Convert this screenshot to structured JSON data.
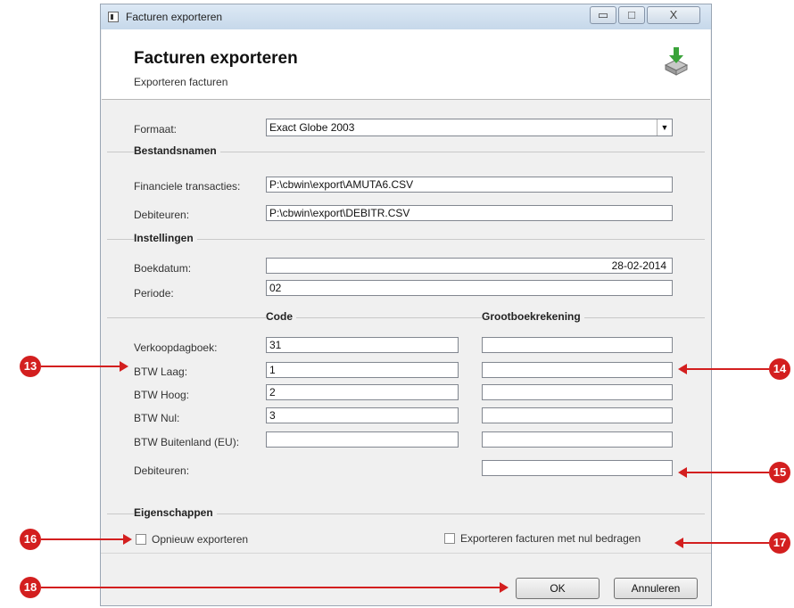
{
  "window": {
    "title": "Facturen exporteren",
    "min_glyph": "▭",
    "max_glyph": "□",
    "close_glyph": "X"
  },
  "header": {
    "title": "Facturen exporteren",
    "subtitle": "Exporteren facturen",
    "icon": "export-printer-icon"
  },
  "form": {
    "format": {
      "label": "Formaat:",
      "value": "Exact Globe 2003",
      "dropdown_glyph": "▼"
    },
    "bestandsnamen": {
      "heading": "Bestandsnamen",
      "financiele": {
        "label": "Financiele transacties:",
        "value": "P:\\cbwin\\export\\AMUTA6.CSV"
      },
      "debiteuren": {
        "label": "Debiteuren:",
        "value": "P:\\cbwin\\export\\DEBITR.CSV"
      }
    },
    "instellingen": {
      "heading": "Instellingen",
      "boekdatum": {
        "label": "Boekdatum:",
        "value": "28-02-2014"
      },
      "periode": {
        "label": "Periode:",
        "value": "02"
      }
    },
    "codes": {
      "code_heading": "Code",
      "gb_heading": "Grootboekrekening",
      "rows": [
        {
          "label": "Verkoopdagboek:",
          "code": "31",
          "gb": ""
        },
        {
          "label": "BTW Laag:",
          "code": "1",
          "gb": ""
        },
        {
          "label": "BTW Hoog:",
          "code": "2",
          "gb": ""
        },
        {
          "label": "BTW Nul:",
          "code": "3",
          "gb": ""
        },
        {
          "label": "BTW Buitenland (EU):",
          "code": "",
          "gb": ""
        }
      ],
      "debiteuren": {
        "label": "Debiteuren:",
        "gb": ""
      }
    },
    "eigenschappen": {
      "heading": "Eigenschappen",
      "opnieuw": {
        "label": "Opnieuw exporteren",
        "checked": false
      },
      "nul_bedragen": {
        "label": "Exporteren facturen met nul bedragen",
        "checked": false
      }
    }
  },
  "buttons": {
    "ok": "OK",
    "cancel": "Annuleren"
  },
  "callouts": [
    "13",
    "14",
    "15",
    "16",
    "17",
    "18"
  ],
  "colors": {
    "callout": "#d31f1f",
    "dialog_bg": "#f0f0f0",
    "titlebar": "#c6d8ea"
  }
}
